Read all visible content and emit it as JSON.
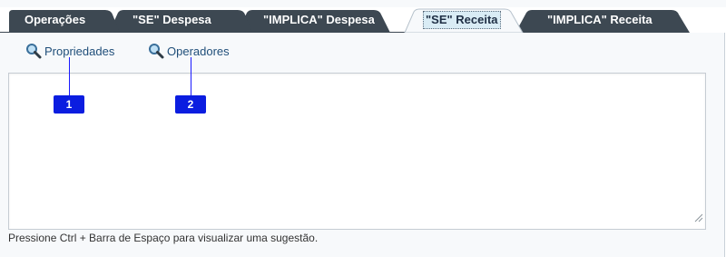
{
  "tabs": [
    {
      "label": "Operações",
      "active": false
    },
    {
      "label": "\"SE\" Despesa",
      "active": false
    },
    {
      "label": "\"IMPLICA\" Despesa",
      "active": false
    },
    {
      "label": "\"SE\" Receita",
      "active": true
    },
    {
      "label": "\"IMPLICA\" Receita",
      "active": false
    }
  ],
  "toolbar": {
    "properties_label": "Propriedades",
    "operators_label": "Operadores"
  },
  "editor": {
    "value": ""
  },
  "hint": "Pressione Ctrl + Barra de Espaço para visualizar uma sugestão.",
  "callouts": [
    {
      "label": "1"
    },
    {
      "label": "2"
    }
  ],
  "colors": {
    "tab_inactive": "#3d4852",
    "tab_active": "#f7f9fb",
    "link": "#1f4e79",
    "badge": "#0b1de0"
  }
}
